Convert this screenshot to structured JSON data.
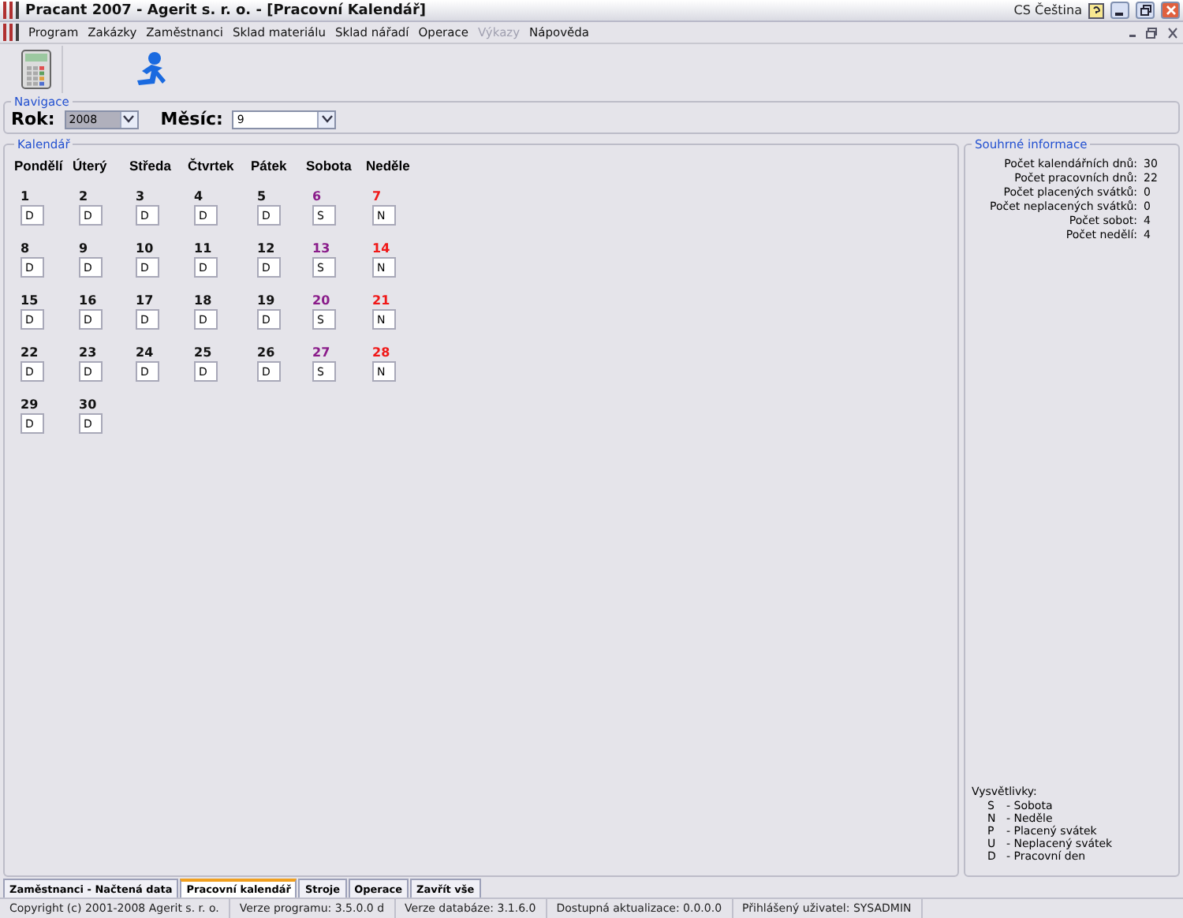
{
  "window": {
    "title": "Pracant 2007 - Agerit s. r. o. - [Pracovní Kalendář]",
    "language_code": "CS",
    "language": "Čeština"
  },
  "menu": [
    {
      "label": "Program",
      "disabled": false
    },
    {
      "label": "Zakázky",
      "disabled": false
    },
    {
      "label": "Zaměstnanci",
      "disabled": false
    },
    {
      "label": "Sklad materiálu",
      "disabled": false
    },
    {
      "label": "Sklad nářadí",
      "disabled": false
    },
    {
      "label": "Operace",
      "disabled": false
    },
    {
      "label": "Výkazy",
      "disabled": true
    },
    {
      "label": "Nápověda",
      "disabled": false
    }
  ],
  "navigation": {
    "title": "Navigace",
    "year_label": "Rok:",
    "year": "2008",
    "month_label": "Měsíc:",
    "month": "9"
  },
  "calendar": {
    "title": "Kalendář",
    "weekdays": [
      "Pondělí",
      "Úterý",
      "Středa",
      "Čtvrtek",
      "Pátek",
      "Sobota",
      "Neděle"
    ],
    "days": [
      {
        "day": "1",
        "code": "D",
        "kind": "workday"
      },
      {
        "day": "2",
        "code": "D",
        "kind": "workday"
      },
      {
        "day": "3",
        "code": "D",
        "kind": "workday"
      },
      {
        "day": "4",
        "code": "D",
        "kind": "workday"
      },
      {
        "day": "5",
        "code": "D",
        "kind": "workday"
      },
      {
        "day": "6",
        "code": "S",
        "kind": "saturday"
      },
      {
        "day": "7",
        "code": "N",
        "kind": "sunday"
      },
      {
        "day": "8",
        "code": "D",
        "kind": "workday"
      },
      {
        "day": "9",
        "code": "D",
        "kind": "workday"
      },
      {
        "day": "10",
        "code": "D",
        "kind": "workday"
      },
      {
        "day": "11",
        "code": "D",
        "kind": "workday"
      },
      {
        "day": "12",
        "code": "D",
        "kind": "workday"
      },
      {
        "day": "13",
        "code": "S",
        "kind": "saturday"
      },
      {
        "day": "14",
        "code": "N",
        "kind": "sunday"
      },
      {
        "day": "15",
        "code": "D",
        "kind": "workday"
      },
      {
        "day": "16",
        "code": "D",
        "kind": "workday"
      },
      {
        "day": "17",
        "code": "D",
        "kind": "workday"
      },
      {
        "day": "18",
        "code": "D",
        "kind": "workday"
      },
      {
        "day": "19",
        "code": "D",
        "kind": "workday"
      },
      {
        "day": "20",
        "code": "S",
        "kind": "saturday"
      },
      {
        "day": "21",
        "code": "N",
        "kind": "sunday"
      },
      {
        "day": "22",
        "code": "D",
        "kind": "workday"
      },
      {
        "day": "23",
        "code": "D",
        "kind": "workday"
      },
      {
        "day": "24",
        "code": "D",
        "kind": "workday"
      },
      {
        "day": "25",
        "code": "D",
        "kind": "workday"
      },
      {
        "day": "26",
        "code": "D",
        "kind": "workday"
      },
      {
        "day": "27",
        "code": "S",
        "kind": "saturday"
      },
      {
        "day": "28",
        "code": "N",
        "kind": "sunday"
      },
      {
        "day": "29",
        "code": "D",
        "kind": "workday"
      },
      {
        "day": "30",
        "code": "D",
        "kind": "workday"
      }
    ]
  },
  "summary": {
    "title": "Souhrné informace",
    "rows": [
      {
        "label": "Počet kalendářních dnů:",
        "value": "30"
      },
      {
        "label": "Počet pracovních dnů:",
        "value": "22"
      },
      {
        "label": "Počet placených svátků:",
        "value": "0"
      },
      {
        "label": "Počet neplacených svátků:",
        "value": "0"
      },
      {
        "label": "Počet sobot:",
        "value": "4"
      },
      {
        "label": "Počet nedělí:",
        "value": "4"
      }
    ],
    "legend_title": "Vysvětlivky:",
    "legend": [
      {
        "code": "S",
        "text": "- Sobota"
      },
      {
        "code": "N",
        "text": "- Neděle"
      },
      {
        "code": "P",
        "text": "- Placený svátek"
      },
      {
        "code": "U",
        "text": "- Neplacený svátek"
      },
      {
        "code": "D",
        "text": "- Pracovní den"
      }
    ]
  },
  "tabs": [
    {
      "label": "Zaměstnanci - Načtená data",
      "selected": false
    },
    {
      "label": "Pracovní kalendář",
      "selected": true
    },
    {
      "label": "Stroje",
      "selected": false
    },
    {
      "label": "Operace",
      "selected": false
    },
    {
      "label": "Zavřít vše",
      "selected": false
    }
  ],
  "status_bar": [
    "Copyright (c) 2001-2008 Agerit s. r. o.",
    "Verze programu: 3.5.0.0 d",
    "Verze databáze: 3.1.6.0",
    "Dostupná aktualizace: 0.0.0.0",
    "Přihlášený uživatel: SYSADMIN"
  ]
}
